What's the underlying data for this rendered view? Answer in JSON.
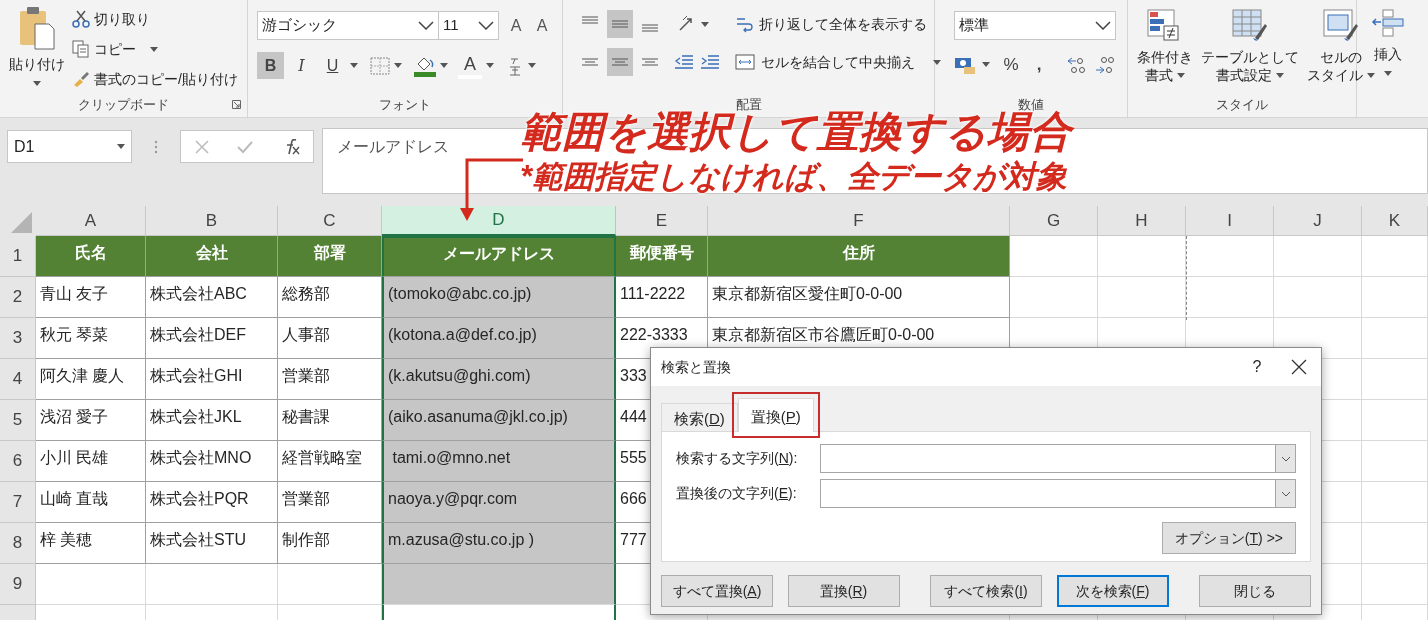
{
  "ribbon": {
    "clipboard": {
      "paste": "貼り付け",
      "items": [
        "切り取り",
        "コピー",
        "書式のコピー/貼り付け"
      ],
      "label": "クリップボード"
    },
    "font": {
      "font_name": "游ゴシック",
      "font_size": "11",
      "size_buttons": [
        "A",
        "A"
      ],
      "format_buttons": [
        {
          "label": "B",
          "selected": true
        },
        {
          "label": "I",
          "selected": false
        },
        {
          "label": "U",
          "selected": false
        }
      ],
      "font_color": "A",
      "label": "フォント"
    },
    "alignment": {
      "vertical_align": [
        {
          "selected": false
        },
        {
          "selected": true
        },
        {
          "selected": false
        }
      ],
      "horizontal_align": [
        {
          "selected": false
        },
        {
          "selected": true
        },
        {
          "selected": false
        }
      ],
      "wrap": "折り返して全体を表示する",
      "merge": "セルを結合して中央揃え",
      "label": "配置"
    },
    "number": {
      "format": "標準",
      "symbols": [
        "%",
        ","
      ],
      "label": "数値"
    },
    "styles": {
      "buttons": [
        {
          "lines": [
            "条件付き",
            "書式"
          ]
        },
        {
          "lines": [
            "テーブルとして",
            "書式設定"
          ]
        },
        {
          "lines": [
            "セルの",
            "スタイル"
          ]
        }
      ],
      "label": "スタイル"
    },
    "cells": {
      "insert": "挿入"
    }
  },
  "formula_bar": {
    "name_box": "D1",
    "formula": "メールアドレス"
  },
  "annotation": {
    "title": "範囲を選択して置換する場合",
    "note": "*範囲指定しなければ、全データが対象"
  },
  "sheet": {
    "columns": [
      {
        "label": "A",
        "selected": false
      },
      {
        "label": "B",
        "selected": false
      },
      {
        "label": "C",
        "selected": false
      },
      {
        "label": "D",
        "selected": true
      },
      {
        "label": "E",
        "selected": false
      },
      {
        "label": "F",
        "selected": false
      },
      {
        "label": "G",
        "selected": false
      },
      {
        "label": "H",
        "selected": false
      },
      {
        "label": "I",
        "selected": false
      },
      {
        "label": "J",
        "selected": false
      },
      {
        "label": "K",
        "selected": false
      }
    ],
    "rows": [
      {
        "label": "1",
        "kind": "header",
        "cells": [
          "氏名",
          "会社",
          "部署",
          "メールアドレス",
          "郵便番号",
          "住所"
        ]
      },
      {
        "label": "2",
        "kind": "data",
        "cells": [
          "青山 友子",
          "株式会社ABC",
          "総務部",
          "(tomoko@abc.co.jp)",
          "111-2222",
          "東京都新宿区愛住町0-0-00"
        ]
      },
      {
        "label": "3",
        "kind": "data",
        "cells": [
          "秋元 琴菜",
          "株式会社DEF",
          "人事部",
          "(kotona.a@def.co.jp)",
          "222-3333",
          "東京都新宿区市谷鷹匠町0-0-00"
        ]
      },
      {
        "label": "4",
        "kind": "data",
        "cells": [
          "阿久津 慶人",
          "株式会社GHI",
          "営業部",
          "(k.akutsu@ghi.com)",
          "333"
        ]
      },
      {
        "label": "5",
        "kind": "data",
        "cells": [
          "浅沼 愛子",
          "株式会社JKL",
          "秘書課",
          "(aiko.asanuma@jkl.co.jp)",
          "444"
        ]
      },
      {
        "label": "6",
        "kind": "data",
        "cells": [
          "小川 民雄",
          "株式会社MNO",
          "経営戦略室",
          " tami.o@mno.net",
          "555"
        ]
      },
      {
        "label": "7",
        "kind": "data",
        "cells": [
          "山崎 直哉",
          "株式会社PQR",
          "営業部",
          "naoya.y@pqr.com",
          "666"
        ]
      },
      {
        "label": "8",
        "kind": "data",
        "cells": [
          "梓 美穂",
          "株式会社STU",
          "制作部",
          "m.azusa@stu.co.jp )",
          "777"
        ]
      },
      {
        "label": "9",
        "kind": "data"
      }
    ]
  },
  "dialog": {
    "title": "検索と置換",
    "help": "?",
    "tabs": [
      {
        "label": [
          "検索(",
          "D",
          ")"
        ],
        "selected": false,
        "highlighted": false
      },
      {
        "label": [
          "置換(",
          "P",
          ")"
        ],
        "selected": true,
        "highlighted": true
      }
    ],
    "fields": [
      {
        "label": [
          "検索する文字列(",
          "N",
          "):"
        ]
      },
      {
        "label": [
          "置換後の文字列(",
          "E",
          "):"
        ]
      }
    ],
    "options": [
      "オプション(",
      "T",
      ") >>"
    ],
    "buttons": [
      {
        "label": [
          "すべて置換(",
          "A",
          ")"
        ],
        "default": false
      },
      {
        "label": [
          "置換(",
          "R",
          ")"
        ],
        "default": false
      },
      {
        "label": [
          "すべて検索(",
          "I",
          ")"
        ],
        "default": false
      },
      {
        "label": [
          "次を検索(",
          "F",
          ")"
        ],
        "default": true
      },
      {
        "label": [
          "閉じる"
        ],
        "default": false
      }
    ]
  }
}
